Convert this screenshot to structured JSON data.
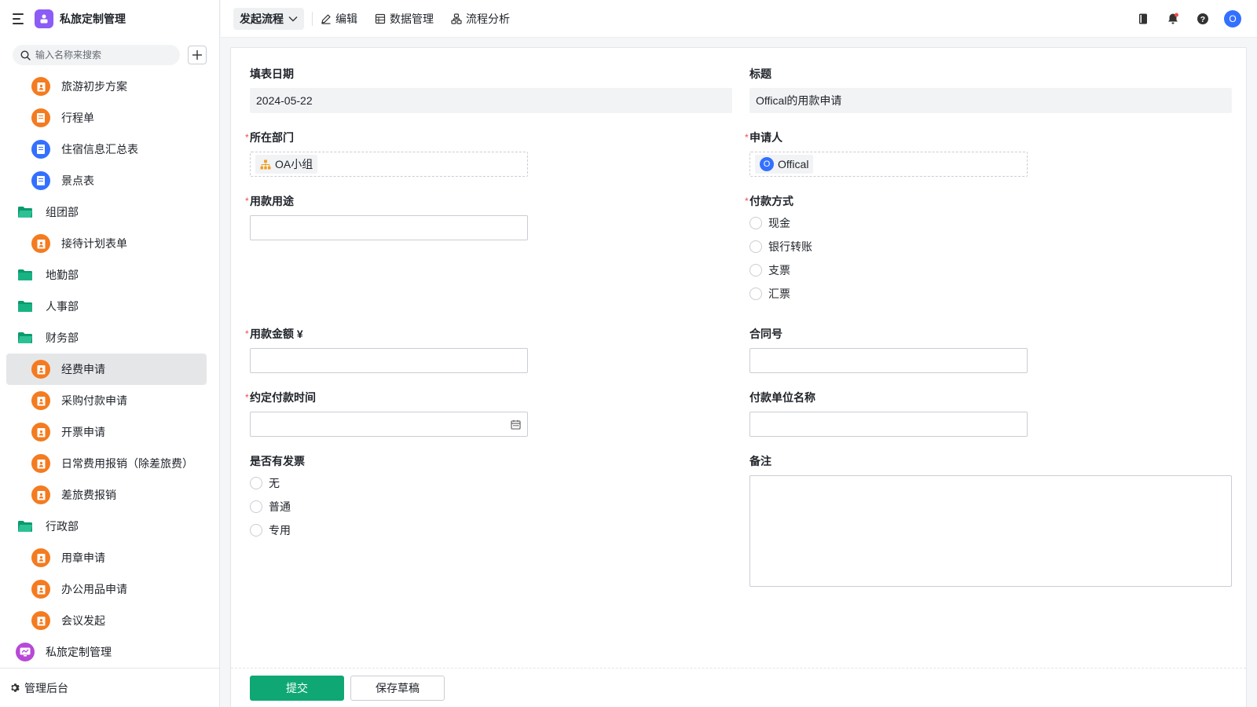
{
  "app": {
    "title": "私旅定制管理",
    "brand_color": "#8b5cf6"
  },
  "sidebar": {
    "search_placeholder": "输入名称来搜索",
    "items": [
      {
        "label": "旅游初步方案",
        "kind": "child",
        "icon": "orange-form-icon"
      },
      {
        "label": "行程单",
        "kind": "child",
        "icon": "orange-doc-icon"
      },
      {
        "label": "住宿信息汇总表",
        "kind": "child",
        "icon": "blue-doc-icon"
      },
      {
        "label": "景点表",
        "kind": "child",
        "icon": "blue-doc-icon"
      },
      {
        "label": "组团部",
        "kind": "folder",
        "icon": "folder-open-icon"
      },
      {
        "label": "接待计划表单",
        "kind": "child",
        "icon": "orange-form-icon"
      },
      {
        "label": "地勤部",
        "kind": "folder",
        "icon": "folder-icon"
      },
      {
        "label": "人事部",
        "kind": "folder",
        "icon": "folder-icon"
      },
      {
        "label": "财务部",
        "kind": "folder",
        "icon": "folder-open-icon"
      },
      {
        "label": "经费申请",
        "kind": "child",
        "icon": "orange-form-icon",
        "active": true
      },
      {
        "label": "采购付款申请",
        "kind": "child",
        "icon": "orange-form-icon"
      },
      {
        "label": "开票申请",
        "kind": "child",
        "icon": "orange-form-icon"
      },
      {
        "label": "日常费用报销（除差旅费）",
        "kind": "child",
        "icon": "orange-form-icon"
      },
      {
        "label": "差旅费报销",
        "kind": "child",
        "icon": "orange-form-icon"
      },
      {
        "label": "行政部",
        "kind": "folder",
        "icon": "folder-open-icon"
      },
      {
        "label": "用章申请",
        "kind": "child",
        "icon": "orange-form-icon"
      },
      {
        "label": "办公用品申请",
        "kind": "child",
        "icon": "orange-form-icon"
      },
      {
        "label": "会议发起",
        "kind": "child",
        "icon": "orange-form-icon"
      },
      {
        "label": "私旅定制管理",
        "kind": "app",
        "icon": "purple-app-icon"
      }
    ],
    "footer_label": "管理后台"
  },
  "toolbar": {
    "launch_label": "发起流程",
    "edit_label": "编辑",
    "data_label": "数据管理",
    "analysis_label": "流程分析",
    "avatar_letter": "O"
  },
  "form": {
    "fill_date": {
      "label": "填表日期",
      "value": "2024-05-22"
    },
    "title": {
      "label": "标题",
      "value": "Offical的用款申请"
    },
    "department": {
      "label": "所在部门",
      "required_mark": "*",
      "value": "OA小组"
    },
    "applicant": {
      "label": "申请人",
      "required_mark": "*",
      "value": "Offical",
      "avatar_letter": "O"
    },
    "purpose": {
      "label": "用款用途",
      "required_mark": "*",
      "value": ""
    },
    "payment_method": {
      "label": "付款方式",
      "required_mark": "*",
      "options": [
        "现金",
        "银行转账",
        "支票",
        "汇票"
      ]
    },
    "amount": {
      "label": "用款金额 ¥",
      "required_mark": "*",
      "value": ""
    },
    "contract_no": {
      "label": "合同号",
      "value": ""
    },
    "pay_time": {
      "label": "约定付款时间",
      "required_mark": "*",
      "value": ""
    },
    "payer_name": {
      "label": "付款单位名称",
      "value": ""
    },
    "invoice": {
      "label": "是否有发票",
      "options": [
        "无",
        "普通",
        "专用"
      ]
    },
    "remark": {
      "label": "备注",
      "value": ""
    }
  },
  "footer": {
    "submit_label": "提交",
    "draft_label": "保存草稿",
    "primary_color": "#0fa875"
  }
}
